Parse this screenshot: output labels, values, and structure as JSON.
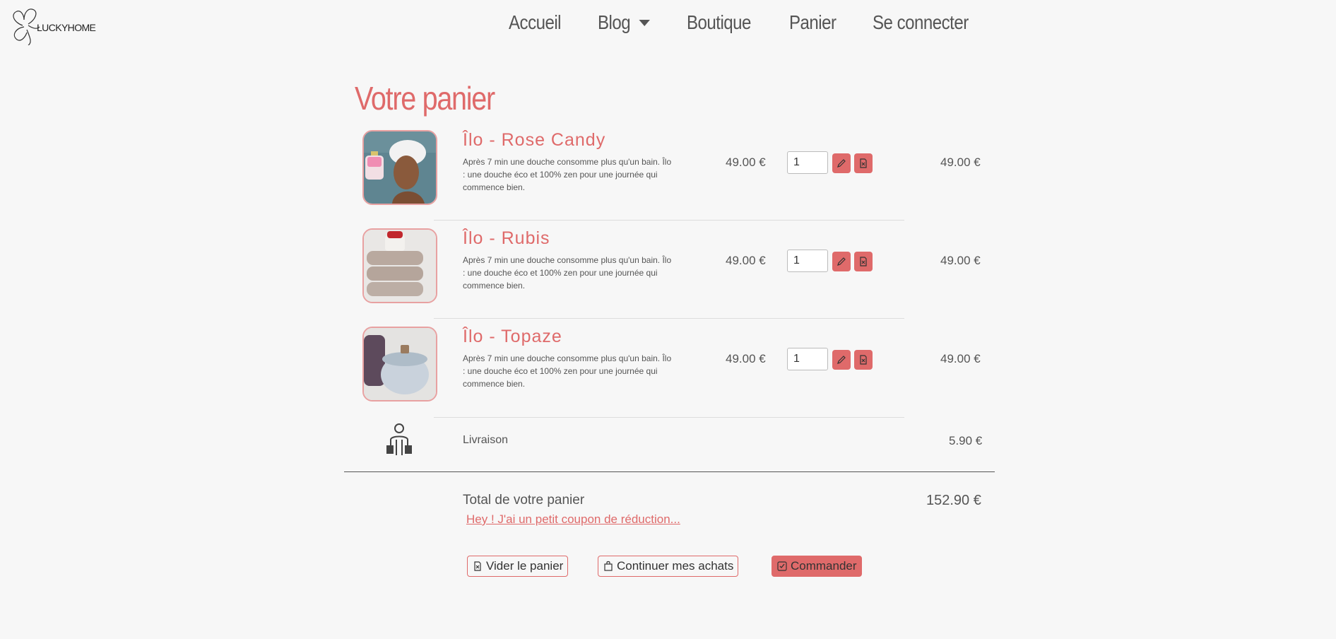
{
  "nav": {
    "logo_text": "LUCKYHOME",
    "items": [
      "Accueil",
      "Blog",
      "Boutique",
      "Panier",
      "Se connecter"
    ]
  },
  "page_title": "Votre panier",
  "cart": {
    "items": [
      {
        "name": "Îlo - Rose Candy",
        "description": "Après 7 min une douche consomme plus qu'un bain. Îlo : une douche éco et 100% zen pour une journée qui commence bien.",
        "unit_price": "49.00 €",
        "quantity": "1",
        "line_total": "49.00 €"
      },
      {
        "name": "Îlo - Rubis",
        "description": "Après 7 min une douche consomme plus qu'un bain. Îlo : une douche éco et 100% zen pour une journée qui commence bien.",
        "unit_price": "49.00 €",
        "quantity": "1",
        "line_total": "49.00 €"
      },
      {
        "name": "Îlo - Topaze",
        "description": "Après 7 min une douche consomme plus qu'un bain. Îlo : une douche éco et 100% zen pour une journée qui commence bien.",
        "unit_price": "49.00 €",
        "quantity": "1",
        "line_total": "49.00 €"
      }
    ],
    "shipping_label": "Livraison",
    "shipping_price": "5.90 €",
    "total_label": "Total de votre panier",
    "total_value": "152.90 €",
    "coupon_link": "Hey ! J'ai un petit coupon de réduction..."
  },
  "actions": {
    "empty_cart": "Vider le panier",
    "continue_shopping": "Continuer mes achats",
    "order": "Commander"
  },
  "colors": {
    "accent": "#df6a6a",
    "background": "#f7f7f7",
    "text": "#555555"
  }
}
